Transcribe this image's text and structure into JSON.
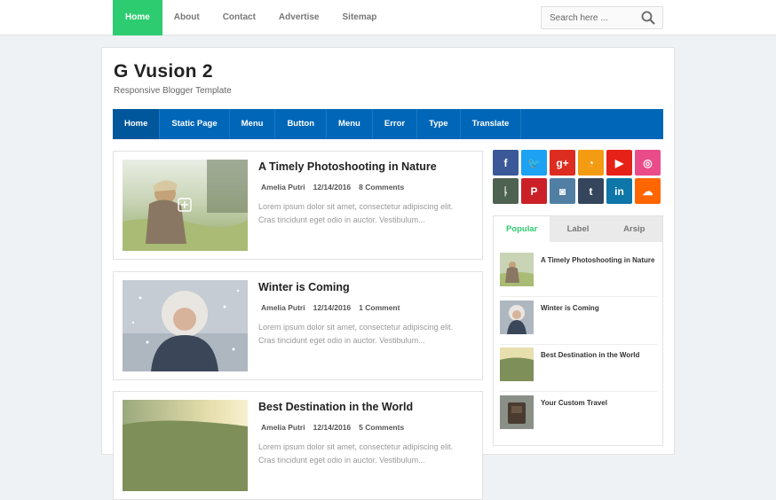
{
  "topnav": {
    "items": [
      {
        "label": "Home",
        "active": true
      },
      {
        "label": "About"
      },
      {
        "label": "Contact"
      },
      {
        "label": "Advertise"
      },
      {
        "label": "Sitemap"
      }
    ]
  },
  "search": {
    "placeholder": "Search here ..."
  },
  "header": {
    "title": "G Vusion 2",
    "subtitle": "Responsive Blogger Template"
  },
  "mainnav": {
    "items": [
      {
        "label": "Home",
        "active": true
      },
      {
        "label": "Static Page"
      },
      {
        "label": "Menu"
      },
      {
        "label": "Button"
      },
      {
        "label": "Menu"
      },
      {
        "label": "Error"
      },
      {
        "label": "Type"
      },
      {
        "label": "Translate"
      }
    ]
  },
  "posts": [
    {
      "title": "A Timely Photoshooting in Nature",
      "author": "Amelia Putri",
      "date": "12/14/2016",
      "comments": "8 Comments",
      "excerpt": "Lorem ipsum dolor sit amet, consectetur adipiscing elit. Cras tincidunt eget odio in auctor. Vestibulum..."
    },
    {
      "title": "Winter is Coming",
      "author": "Amelia Putri",
      "date": "12/14/2016",
      "comments": "1 Comment",
      "excerpt": "Lorem ipsum dolor sit amet, consectetur adipiscing elit. Cras tincidunt eget odio in auctor. Vestibulum..."
    },
    {
      "title": "Best Destination in the World",
      "author": "Amelia Putri",
      "date": "12/14/2016",
      "comments": "5 Comments",
      "excerpt": "Lorem ipsum dolor sit amet, consectetur adipiscing elit. Cras tincidunt eget odio in auctor. Vestibulum..."
    }
  ],
  "social": [
    {
      "icon": "facebook-icon",
      "glyph": "f",
      "color": "#3b5998"
    },
    {
      "icon": "twitter-icon",
      "glyph": "🐦",
      "color": "#1da1f2"
    },
    {
      "icon": "google-plus-icon",
      "glyph": "g+",
      "color": "#dd2c20"
    },
    {
      "icon": "rss-icon",
      "glyph": "◔",
      "color": "#f39c12"
    },
    {
      "icon": "youtube-icon",
      "glyph": "▶",
      "color": "#e62117"
    },
    {
      "icon": "dribbble-icon",
      "glyph": "◎",
      "color": "#ea4c89"
    },
    {
      "icon": "deviantart-icon",
      "glyph": "ᚿ",
      "color": "#4e6252"
    },
    {
      "icon": "pinterest-icon",
      "glyph": "P",
      "color": "#cb2027"
    },
    {
      "icon": "instagram-icon",
      "glyph": "◙",
      "color": "#517fa4"
    },
    {
      "icon": "tumblr-icon",
      "glyph": "t",
      "color": "#35465c"
    },
    {
      "icon": "linkedin-icon",
      "glyph": "in",
      "color": "#0e76a8"
    },
    {
      "icon": "soundcloud-icon",
      "glyph": "☁",
      "color": "#ff6600"
    }
  ],
  "widget": {
    "tabs": [
      {
        "label": "Popular",
        "active": true
      },
      {
        "label": "Label"
      },
      {
        "label": "Arsip"
      }
    ],
    "popular": [
      {
        "title": "A Timely Photoshooting in Nature"
      },
      {
        "title": "Winter is Coming"
      },
      {
        "title": "Best Destination in the World"
      },
      {
        "title": "Your Custom Travel"
      }
    ]
  }
}
